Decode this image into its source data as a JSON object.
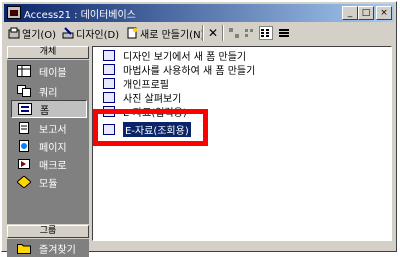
{
  "window": {
    "title": "Access21 : 데이터베이스"
  },
  "titlebar_buttons": {
    "minimize": "_",
    "maximize": "□",
    "close": "×"
  },
  "toolbar": {
    "open_label": "열기(O)",
    "design_label": "디자인(D)",
    "new_label": "새로 만들기(N)",
    "delete_glyph": "✕"
  },
  "sidebar": {
    "objects_header": "개체",
    "items": [
      {
        "label": "테이블",
        "icon": "table-icon"
      },
      {
        "label": "쿼리",
        "icon": "query-icon"
      },
      {
        "label": "폼",
        "icon": "form-icon",
        "active": true
      },
      {
        "label": "보고서",
        "icon": "report-icon"
      },
      {
        "label": "페이지",
        "icon": "page-icon"
      },
      {
        "label": "매크로",
        "icon": "macro-icon"
      },
      {
        "label": "모듈",
        "icon": "module-icon"
      }
    ],
    "groups_header": "그룹",
    "favorites_label": "즐겨찾기"
  },
  "list": {
    "items": [
      {
        "label": "디자인 보기에서 새 폼 만들기",
        "icon": "design-wizard-icon"
      },
      {
        "label": "마법사를 사용하여 새 폼 만들기",
        "icon": "wizard-icon"
      },
      {
        "label": "개인프로필",
        "icon": "form-icon"
      },
      {
        "label": "사진 살펴보기",
        "icon": "form-icon"
      },
      {
        "label": "E-자료(입력용)",
        "icon": "form-icon"
      },
      {
        "label": "E-자료(조회용)",
        "icon": "form-icon",
        "selected": true
      }
    ]
  },
  "colors": {
    "highlight": "#ff0000",
    "selection": "#0a246a",
    "sidebar_bg": "#808080"
  }
}
